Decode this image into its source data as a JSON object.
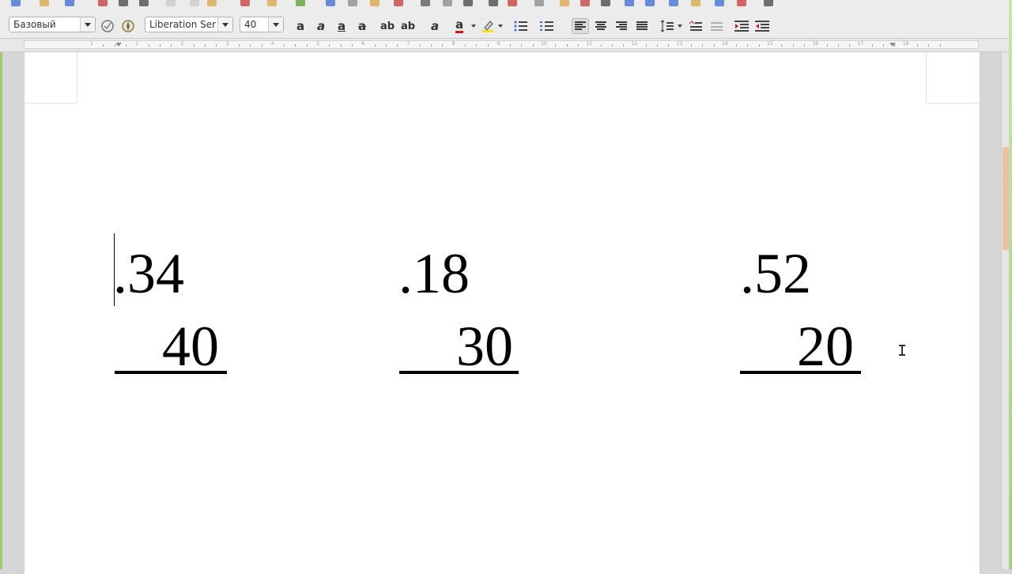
{
  "toolbar": {
    "paragraph_style": "Базовый",
    "font_name": "Liberation Serif",
    "font_size": "40",
    "buttons": [
      {
        "name": "autospellcheck-icon"
      },
      {
        "name": "navigator-icon"
      },
      {
        "name": "bold-icon",
        "glyph": "a"
      },
      {
        "name": "italic-icon",
        "glyph": "a"
      },
      {
        "name": "underline-icon",
        "glyph": "a"
      },
      {
        "name": "strikethrough-icon",
        "glyph": "a"
      },
      {
        "name": "superscript-icon",
        "glyph": "ab"
      },
      {
        "name": "subscript-icon",
        "glyph": "ab"
      },
      {
        "name": "clear-formatting-icon",
        "glyph": "a"
      },
      {
        "name": "font-color-icon",
        "glyph": "a"
      },
      {
        "name": "highlight-icon"
      },
      {
        "name": "bullets-icon"
      },
      {
        "name": "numbering-icon"
      },
      {
        "name": "align-left-icon"
      },
      {
        "name": "align-center-icon"
      },
      {
        "name": "align-right-icon"
      },
      {
        "name": "justify-icon"
      },
      {
        "name": "line-spacing-icon"
      },
      {
        "name": "increase-spacing-icon"
      },
      {
        "name": "decrease-spacing-icon"
      },
      {
        "name": "increase-indent-icon"
      },
      {
        "name": "decrease-indent-icon"
      }
    ],
    "colors": {
      "font_color": "#d41515",
      "highlight": "#f2e21a",
      "accent": "#3b6bd6"
    }
  },
  "ruler": {
    "labels": [
      "1",
      "1",
      "2",
      "3",
      "4",
      "5",
      "6",
      "7",
      "8",
      "9",
      "10",
      "11",
      "12",
      "13",
      "14",
      "15",
      "16",
      "17",
      "18"
    ]
  },
  "document": {
    "problems": [
      {
        "top": ".34",
        "bottom": "40"
      },
      {
        "top": ".18",
        "bottom": "30"
      },
      {
        "top": ".52",
        "bottom": "20"
      }
    ]
  }
}
